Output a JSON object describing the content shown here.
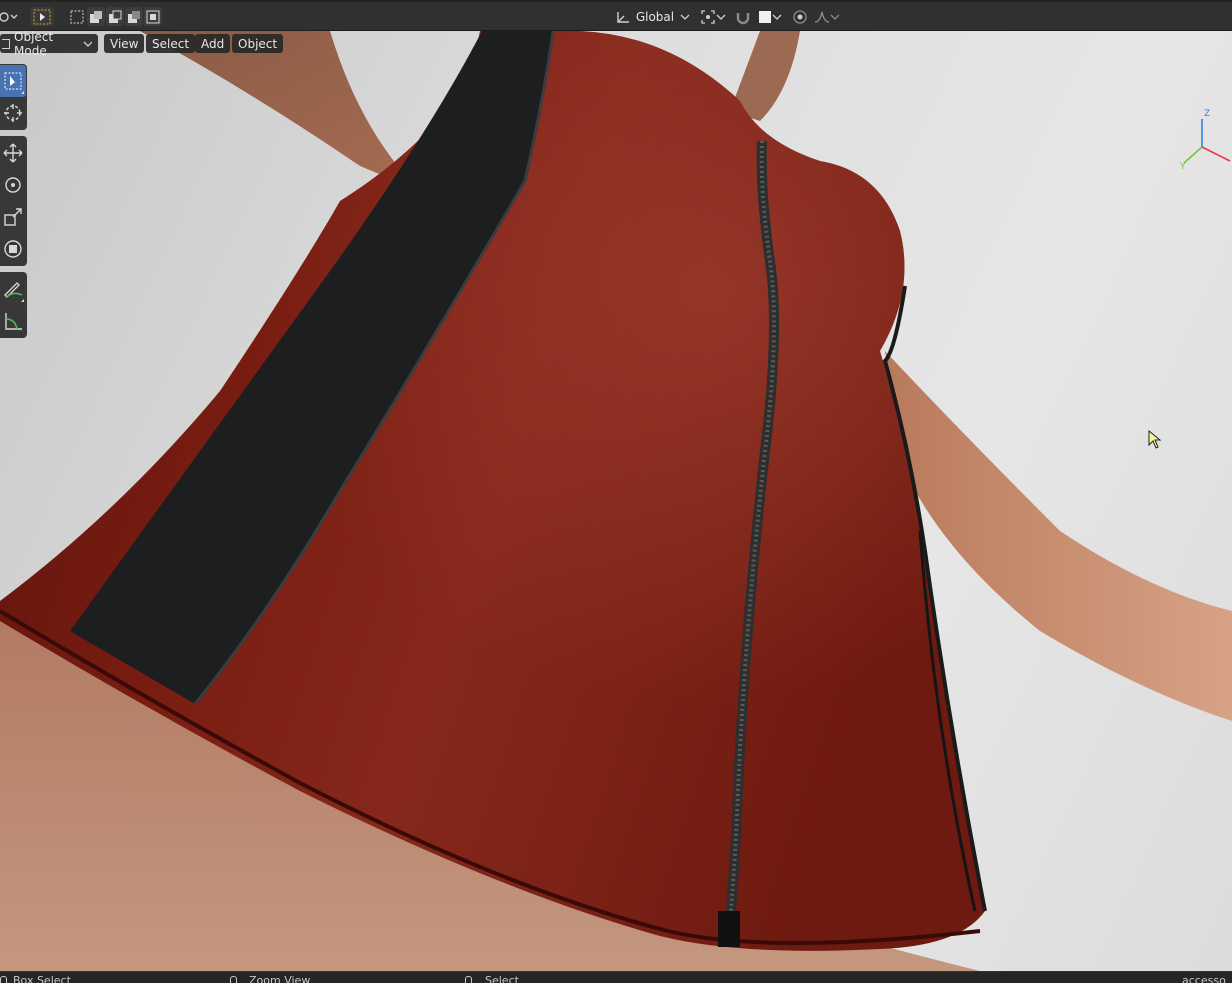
{
  "header": {
    "transform_orientation": "Global",
    "colors": {
      "bar": "#303030",
      "button": "#3d3d3d",
      "active_button": "#545454"
    }
  },
  "menus": {
    "mode": "Object Mode",
    "items": [
      "View",
      "Select",
      "Add",
      "Object"
    ]
  },
  "toolbar": {
    "tools": [
      {
        "name": "select-box-icon",
        "active": true
      },
      {
        "name": "cursor-icon"
      },
      {
        "name": "move-icon"
      },
      {
        "name": "rotate-icon"
      },
      {
        "name": "scale-icon"
      },
      {
        "name": "transform-icon"
      },
      {
        "name": "annotate-icon"
      },
      {
        "name": "measure-icon"
      }
    ],
    "accent": "#4772b3"
  },
  "gizmo": {
    "z": "Z",
    "x": "X",
    "y": "Y",
    "colors": {
      "x": "#e8384f",
      "y": "#7bc142",
      "z": "#2f84e3"
    }
  },
  "statusbar": {
    "left": "Box Select",
    "middle": "Zoom View",
    "right": "Select",
    "far_right": "accesso"
  },
  "scene": {
    "colors": {
      "dress": "#7a1a10",
      "strap": "#1c1e20",
      "skin": "#c9917a",
      "background": "#dedede"
    }
  }
}
